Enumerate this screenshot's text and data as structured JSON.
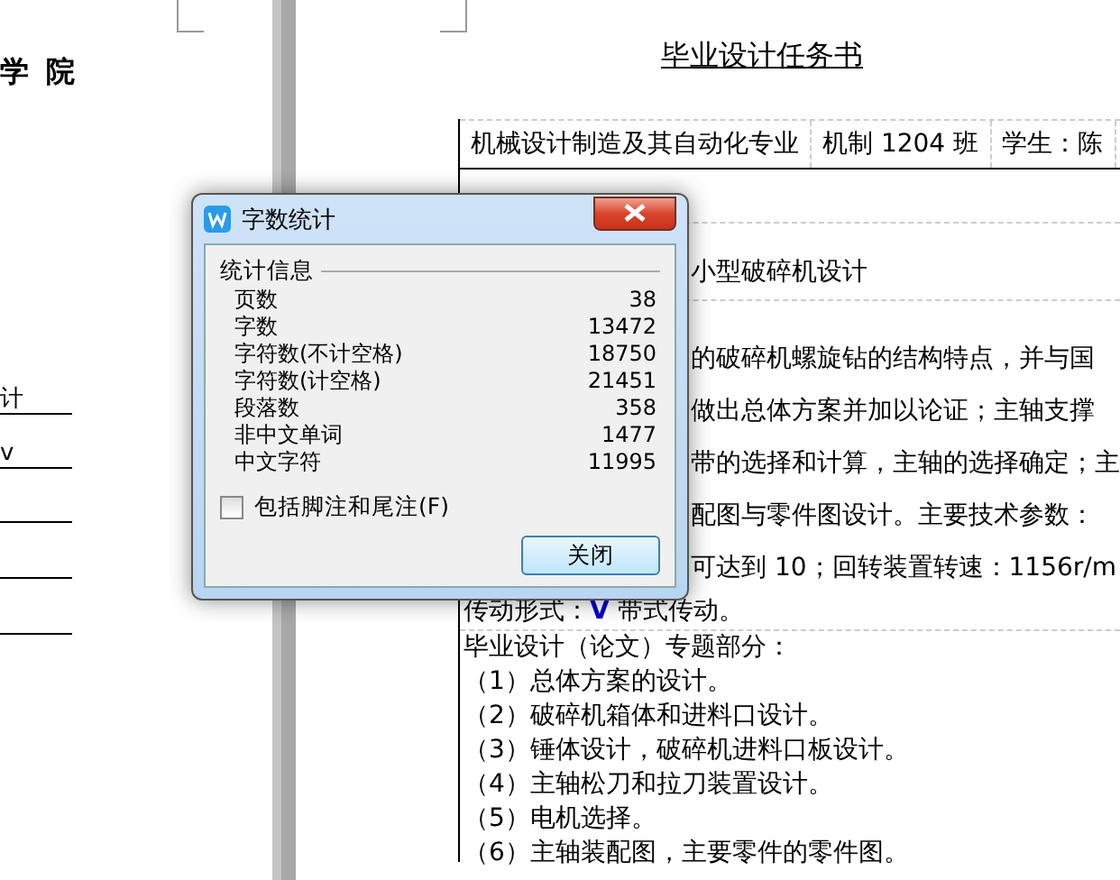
{
  "left_page": {
    "heading": "学 院",
    "lines": [
      {
        "text": "计"
      },
      {
        "text": "v"
      }
    ]
  },
  "document": {
    "title": "毕业设计任务书",
    "header_cells": [
      "机械设计制造及其自动化专业",
      "机制 1204 班",
      "学生：陈"
    ],
    "topic": "小型破碎机设计",
    "body_lines": [
      "的破碎机螺旋钻的结构特点，并与国",
      "做出总体方案并加以论证；主轴支撑",
      "带的选择和计算，主轴的选择确定；主",
      "配图与零件图设计。主要技术参数：",
      "可达到 10；回转装置转速：1156r/m"
    ],
    "full_lines": [
      "传动形式：**V** 带式传动。",
      "毕业设计（论文）专题部分：",
      "（1）总体方案的设计。",
      "（2）破碎机箱体和进料口设计。",
      "（3）锤体设计，破碎机进料口板设计。",
      "（4）主轴松刀和拉刀装置设计。",
      "（5）电机选择。",
      "（6）主轴装配图，主要零件的零件图。"
    ]
  },
  "dialog": {
    "title": "字数统计",
    "group_title": "统计信息",
    "stats": [
      {
        "label": "页数",
        "value": "38"
      },
      {
        "label": "字数",
        "value": "13472"
      },
      {
        "label": "字符数(不计空格)",
        "value": "18750"
      },
      {
        "label": "字符数(计空格)",
        "value": "21451"
      },
      {
        "label": "段落数",
        "value": "358"
      },
      {
        "label": "非中文单词",
        "value": "1477"
      },
      {
        "label": "中文字符",
        "value": "11995"
      }
    ],
    "checkbox": {
      "label": "包括脚注和尾注(F)",
      "checked": false
    },
    "buttons": [
      "关闭"
    ]
  }
}
